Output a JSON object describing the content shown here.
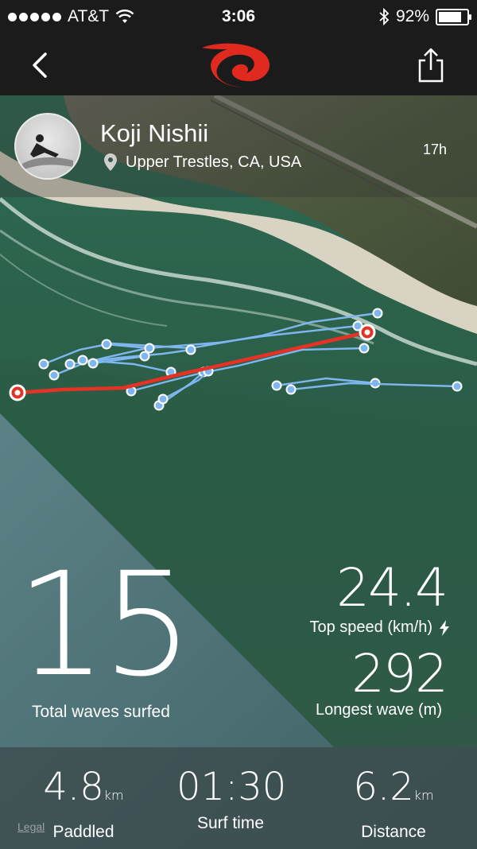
{
  "status_bar": {
    "carrier": "AT&T",
    "time": "3:06",
    "battery_percent": "92%",
    "battery_level": 0.92
  },
  "nav": {
    "back_icon": "chevron-left-icon",
    "logo_icon": "brand-logo",
    "share_icon": "share-icon",
    "brand_color": "#e02a1f"
  },
  "profile": {
    "name": "Koji Nishii",
    "location": "Upper Trestles, CA, USA",
    "time_ago": "17h"
  },
  "stats": {
    "total_waves": "15",
    "total_waves_label": "Total waves surfed",
    "top_speed": "24.4",
    "top_speed_label": "Top speed (km/h)",
    "longest_wave": "292",
    "longest_wave_label": "Longest wave (m)"
  },
  "summary": {
    "paddled_value": "4.8",
    "paddled_unit": "km",
    "paddled_label": "Paddled",
    "surf_time_value": "01:30",
    "surf_time_label": "Surf time",
    "distance_value": "6.2",
    "distance_unit": "km",
    "distance_label": "Distance"
  },
  "legal": "Legal",
  "colors": {
    "track_paddle": "#7fb6ef",
    "track_best_wave": "#e53224"
  }
}
